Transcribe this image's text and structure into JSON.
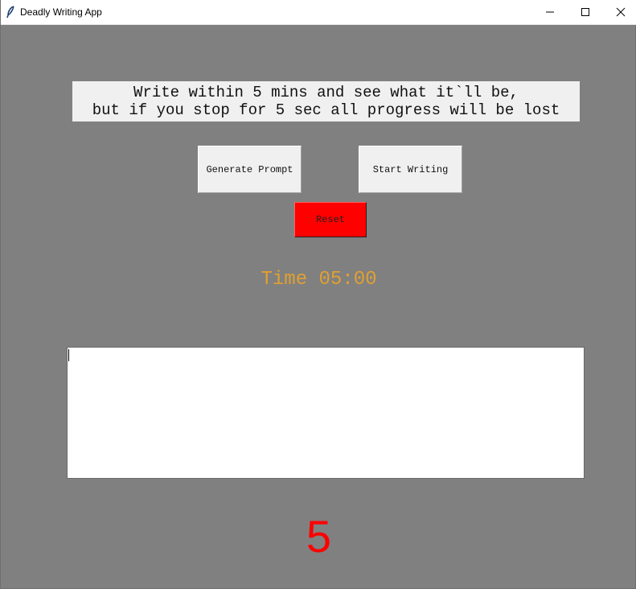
{
  "window": {
    "title": "Deadly Writing App",
    "icon": "feather-icon"
  },
  "intro": {
    "line1": "Write within 5 mins and see what it`ll be,",
    "line2": "but if you stop for 5 sec all progress will be lost"
  },
  "buttons": {
    "generate_prompt": "Generate Prompt",
    "start_writing": "Start Writing",
    "reset": "Reset"
  },
  "timer": {
    "text": "Time 05:00"
  },
  "editor": {
    "value": ""
  },
  "countdown": {
    "value": "5"
  },
  "colors": {
    "background": "#808080",
    "reset_button": "#ff0000",
    "timer_text": "#e0a030",
    "countdown_text": "#ff0000"
  }
}
